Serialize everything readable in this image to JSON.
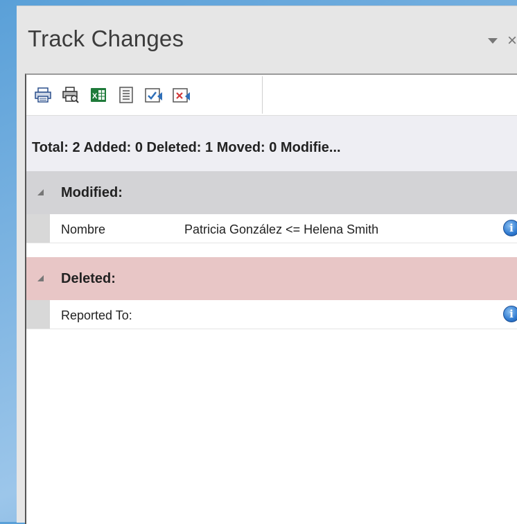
{
  "panel": {
    "title": "Track Changes"
  },
  "toolbar": {
    "buttons": [
      {
        "name": "print-icon"
      },
      {
        "name": "print-preview-icon"
      },
      {
        "name": "excel-export-icon",
        "label": "X"
      },
      {
        "name": "list-report-icon"
      },
      {
        "name": "accept-changes-icon"
      },
      {
        "name": "reject-changes-icon"
      }
    ]
  },
  "summary": {
    "text": "Total: 2 Added: 0 Deleted: 1 Moved: 0 Modifie..."
  },
  "groups": [
    {
      "label": "Modified:",
      "color": "#d3d3d6",
      "rows": [
        {
          "name": "Nombre",
          "value": "Patricia González <= Helena Smith",
          "icon": "info-icon"
        }
      ]
    },
    {
      "label": "Deleted:",
      "color": "#e8c6c6",
      "rows": [
        {
          "name": "Reported To:",
          "value": "",
          "icon": "info-icon"
        }
      ]
    }
  ],
  "info_icon_glyph": "i"
}
